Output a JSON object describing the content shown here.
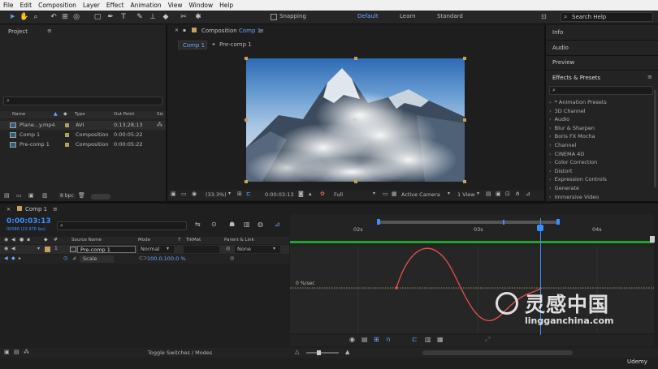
{
  "menu": [
    "File",
    "Edit",
    "Composition",
    "Layer",
    "Effect",
    "Animation",
    "View",
    "Window",
    "Help"
  ],
  "toolbar": {
    "snapping": "Snapping",
    "workspaces": [
      "Default",
      "Learn",
      "Standard"
    ],
    "active_workspace": "Default",
    "search_placeholder": "Search Help"
  },
  "project": {
    "title": "Project",
    "columns": [
      "Name",
      "Type",
      "Out Point",
      "Siz"
    ],
    "items": [
      {
        "name": "Plane...y.mp4",
        "type": "AVI",
        "out": "0;13;28;13"
      },
      {
        "name": "Comp 1",
        "type": "Composition",
        "out": "0:00:05:22"
      },
      {
        "name": "Pre-comp 1",
        "type": "Composition",
        "out": "0:00:05:22"
      }
    ],
    "bpc": "8 bpc"
  },
  "viewer": {
    "title_prefix": "Composition",
    "title_comp": "Comp 1",
    "tabs": [
      "Comp 1",
      "Pre-comp 1"
    ],
    "zoom": "(33.3%)",
    "timecode": "0:00:03:13",
    "resolution": "Full",
    "camera": "Active Camera",
    "views": "1 View"
  },
  "right_panels": {
    "info": "Info",
    "audio": "Audio",
    "preview": "Preview",
    "effects_title": "Effects & Presets",
    "categories": [
      "* Animation Presets",
      "3D Channel",
      "Audio",
      "Blur & Sharpen",
      "Boris FX Mocha",
      "Channel",
      "CINEMA 4D",
      "Color Correction",
      "Distort",
      "Expression Controls",
      "Generate",
      "Immersive Video"
    ]
  },
  "timeline": {
    "tab": "Comp 1",
    "timecode": "0:00:03:13",
    "frames": "00088 (23.976 fps)",
    "columns": {
      "source": "Source Name",
      "mode": "Mode",
      "t": "T",
      "trkmat": "TrkMat",
      "parent": "Parent & Link"
    },
    "layer": {
      "num": "1",
      "name": "Pre-comp 1",
      "mode": "Normal",
      "parent": "None"
    },
    "prop": {
      "name": "Scale",
      "value": "100.0,100.0 %"
    },
    "ruler": [
      "02s",
      "03s",
      "04s"
    ],
    "graph_label": "0 %/sec",
    "toggle": "Toggle Switches / Modes"
  },
  "watermark": {
    "cn": "灵感中国",
    "url": "lingganchina.com",
    "udemy": "Udemy"
  },
  "colors": {
    "accent": "#2d8ceb",
    "timecode": "#2d8ceb",
    "curve": "#e85050",
    "green_bar": "#23a32d"
  }
}
